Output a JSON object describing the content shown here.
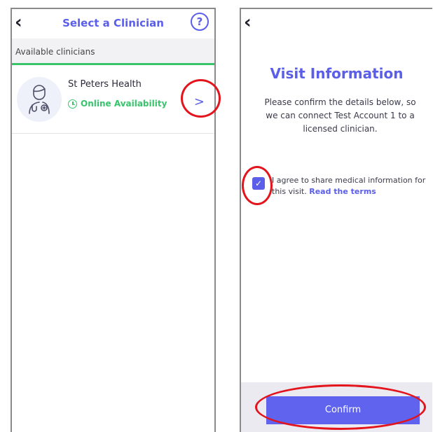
{
  "left_screen": {
    "header": {
      "back_icon": "chevron-left-icon",
      "title": "Select a Clinician",
      "help_icon": "question-circle-icon",
      "help_label": "?"
    },
    "section_label": "Available clinicians",
    "clinician": {
      "name": "St Peters Health",
      "availability": "Online Availability",
      "avatar_icon": "doctor-avatar-icon",
      "chevron_label": ">"
    }
  },
  "right_screen": {
    "header": {
      "back_icon": "chevron-left-icon"
    },
    "title": "Visit Information",
    "description": "Please confirm the details below, so we can connect Test Account 1 to a licensed clinician.",
    "consent": {
      "checked": true,
      "text": "I agree to share medical information for this visit.",
      "link": "Read the terms"
    },
    "confirm_button": "Confirm"
  },
  "colors": {
    "accent": "#5a5ee8",
    "online": "#39c46c",
    "highlight": "#e3141c"
  }
}
